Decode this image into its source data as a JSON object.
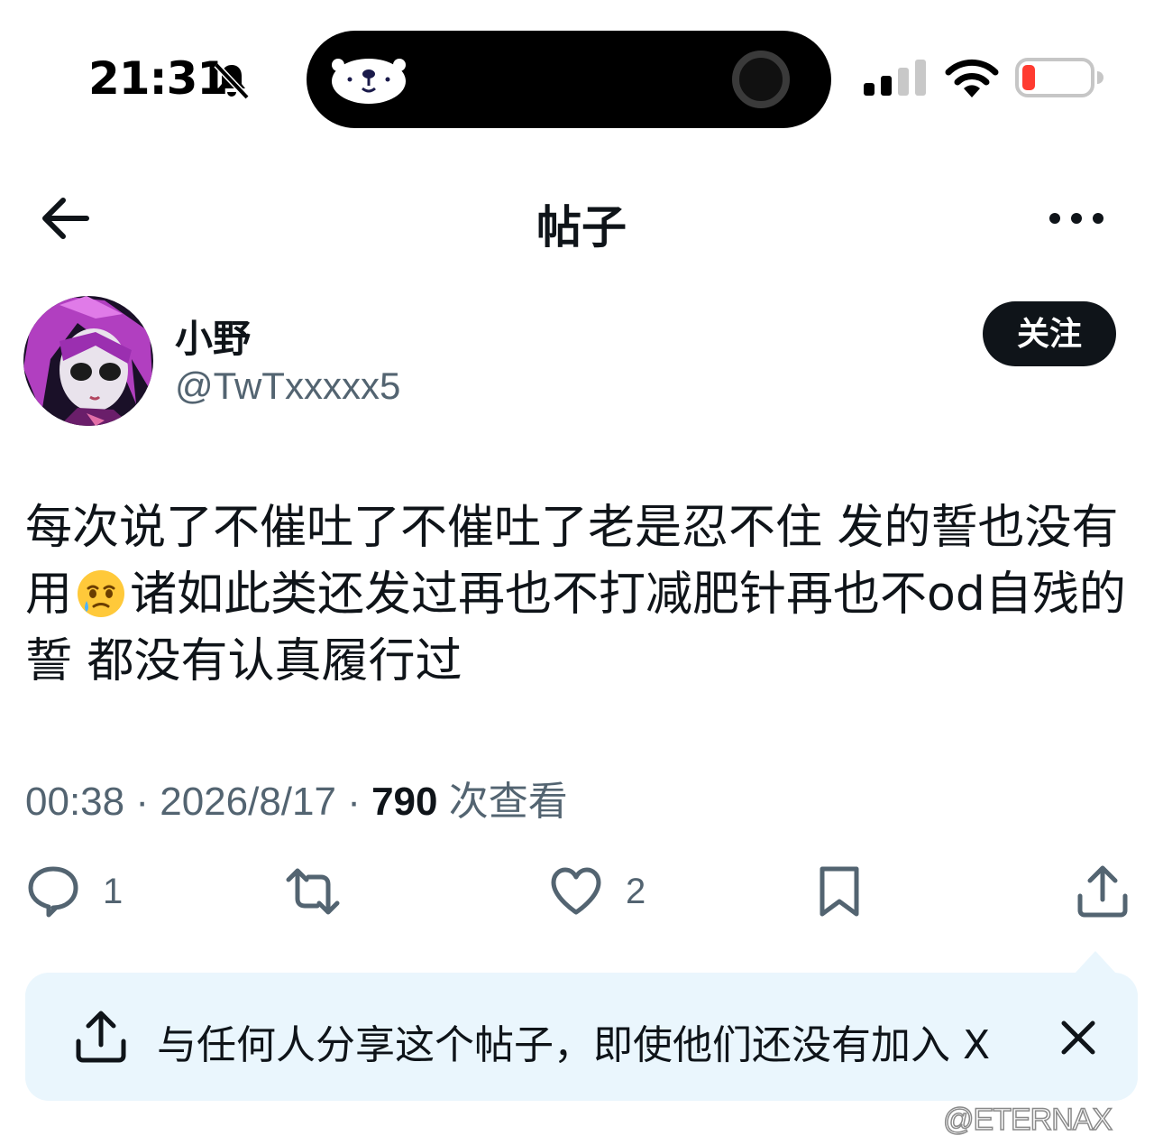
{
  "status_bar": {
    "time": "21:31",
    "battery_color": "#ff3b30"
  },
  "nav": {
    "title": "帖子"
  },
  "author": {
    "name": "小野",
    "handle": "@TwTxxxxx5",
    "follow_label": "关注"
  },
  "post": {
    "text_part1": "每次说了不催吐了不催吐了老是忍不住 发的誓也没有用",
    "emoji": "face-holding-back-tears",
    "text_part2": "诸如此类还发过再也不打减肥针再也不od自残的誓 都没有认真履行过",
    "time": "00:38",
    "sep1": " · ",
    "date": "2026/8/17",
    "sep2": " · ",
    "views": "790",
    "views_label": " 次查看"
  },
  "actions": {
    "replies": "1",
    "likes": "2"
  },
  "share_banner": {
    "text": "与任何人分享这个帖子，即使他们还没有加入 X"
  },
  "watermark": {
    "text": "@ETERNAX"
  }
}
